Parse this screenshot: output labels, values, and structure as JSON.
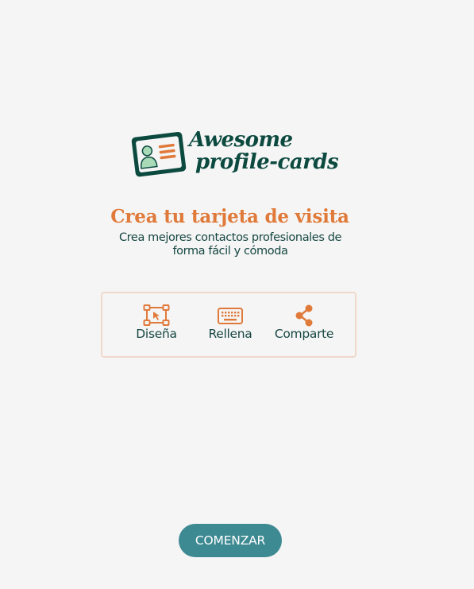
{
  "logo": {
    "line1": "Awesome",
    "line2": "profile-cards",
    "icon": "id-card-icon"
  },
  "hero": {
    "title": "Crea tu tarjeta de visita",
    "subtitle": "Crea mejores contactos profesionales de forma fácil y cómoda"
  },
  "features": [
    {
      "label": "Diseña",
      "icon": "design-icon"
    },
    {
      "label": "Rellena",
      "icon": "keyboard-icon"
    },
    {
      "label": "Comparte",
      "icon": "share-icon"
    }
  ],
  "cta": {
    "label": "COMENZAR"
  },
  "colors": {
    "background": "#f5f5f5",
    "accent_orange": "#e07a3a",
    "dark_green": "#0c4a40",
    "text_teal": "#164742",
    "button_teal": "#3e8a92",
    "border": "#f0d9cb"
  }
}
